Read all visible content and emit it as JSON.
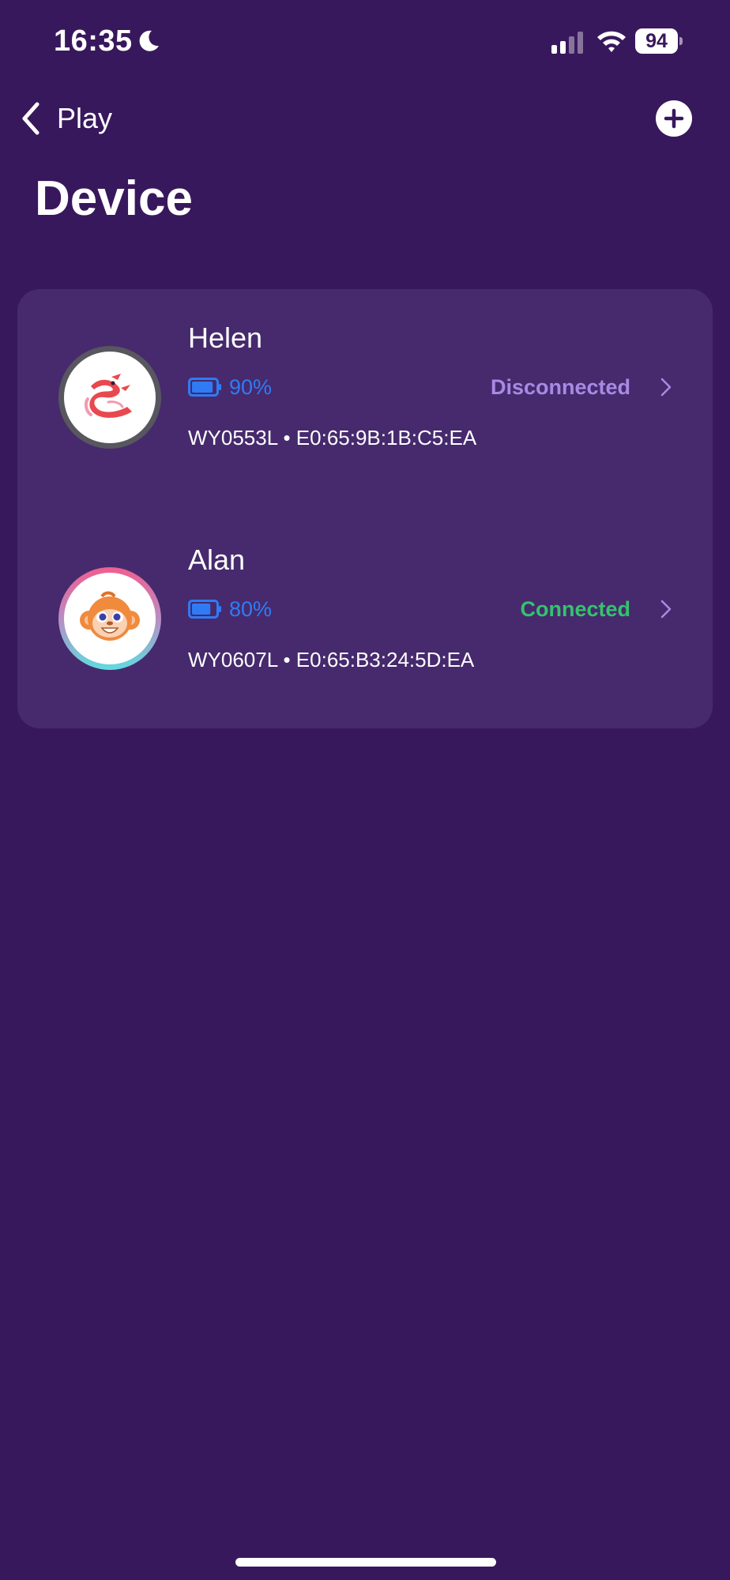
{
  "status_bar": {
    "time": "16:35",
    "battery": "94",
    "icons": [
      "moon-icon",
      "cellular-signal-icon",
      "wifi-icon",
      "battery-icon"
    ]
  },
  "nav": {
    "back_label": "Play",
    "back_icon": "chevron-left-icon",
    "add_icon": "plus-circle-icon"
  },
  "title": "Device",
  "devices": [
    {
      "name": "Helen",
      "battery_pct": "90%",
      "battery_level": 0.9,
      "status": "Disconnected",
      "status_color": "#a88ae4",
      "model": "WY0553L",
      "separator": "•",
      "mac": "E0:65:9B:1B:C5:EA",
      "avatar": "dragon-avatar"
    },
    {
      "name": "Alan",
      "battery_pct": "80%",
      "battery_level": 0.8,
      "status": "Connected",
      "status_color": "#34c36d",
      "model": "WY0607L",
      "separator": "•",
      "mac": "E0:65:B3:24:5D:EA",
      "avatar": "monkey-avatar"
    }
  ],
  "colors": {
    "background": "#38185c",
    "card": "#462a6d",
    "battery_accent": "#2f7bf5"
  }
}
